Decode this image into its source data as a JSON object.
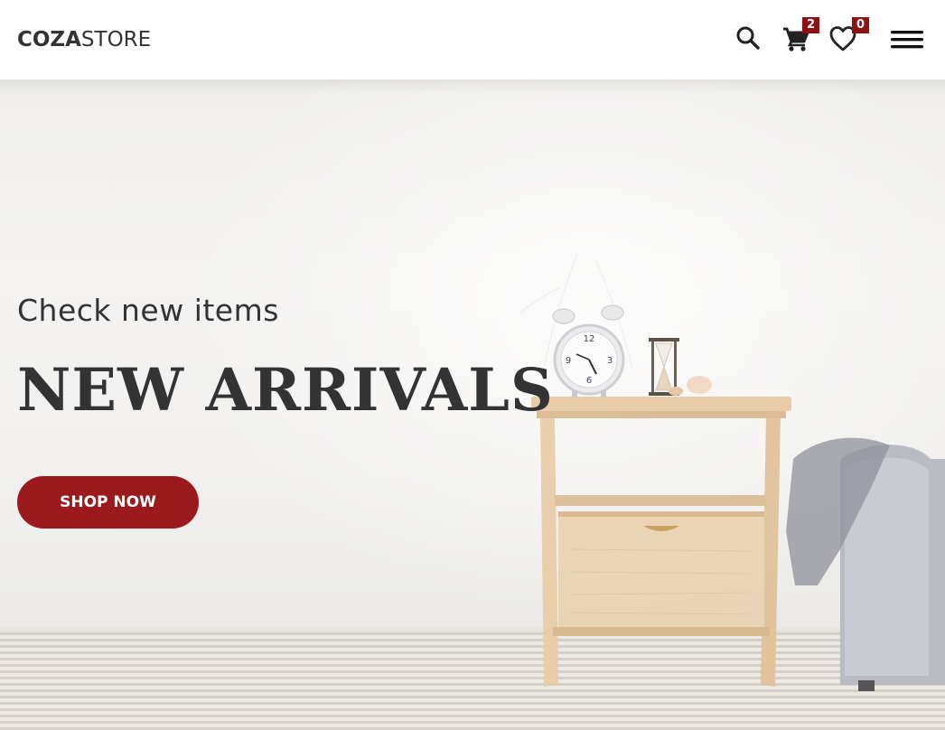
{
  "header": {
    "logo_bold": "COZA",
    "logo_light": "STORE",
    "cart_count": "2",
    "wishlist_count": "0",
    "icons": [
      "search-icon",
      "cart-icon",
      "heart-icon",
      "hamburger-menu-icon"
    ]
  },
  "hero": {
    "subtitle": "Check new items",
    "title": "NEW ARRIVALS",
    "cta_label": "SHOP NOW"
  },
  "colors": {
    "accent": "#9b1a1d",
    "badge": "#8f1111",
    "text": "#333333",
    "background": "#ffffff"
  }
}
